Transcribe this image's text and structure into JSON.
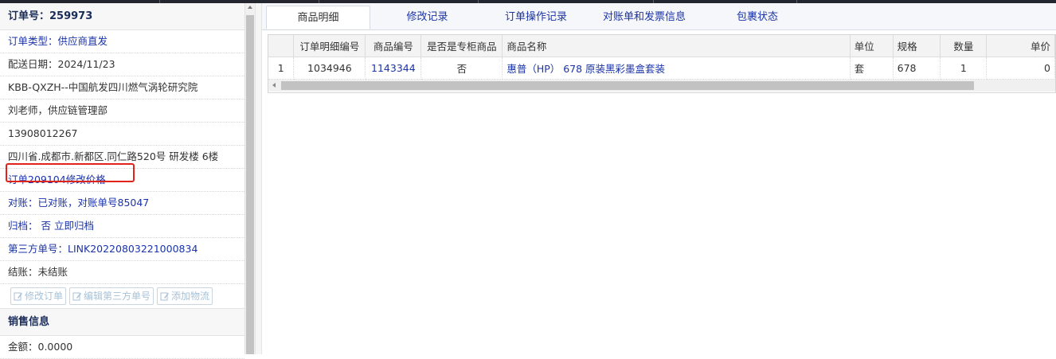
{
  "order": {
    "title": "订单号：259973",
    "type": "订单类型：供应商直发",
    "delivery_date": "配送日期：2024/11/23",
    "customer": "KBB-QXZH--中国航发四川燃气涡轮研究院",
    "contact": "刘老师，供应链管理部",
    "phone": "13908012267",
    "address": "四川省.成都市.新都区.同仁路520号 研发楼 6楼",
    "price_change": "订单209104修改价格",
    "reconcile": "对账：已对账，对账单号85047",
    "archive_prefix": "归档：",
    "archive_status": "否",
    "archive_action": "立即归档",
    "third_party": "第三方单号：LINK20220803221000834",
    "settlement": "结账：未结账"
  },
  "buttons": {
    "edit_order": "修改订单",
    "edit_third_party": "编辑第三方单号",
    "add_logistics": "添加物流"
  },
  "sales": {
    "title": "销售信息",
    "amount": "金额：0.0000"
  },
  "tabs": [
    "商品明细",
    "修改记录",
    "订单操作记录",
    "对账单和发票信息",
    "包裹状态"
  ],
  "table": {
    "headers": [
      "",
      "订单明细编号",
      "商品编号",
      "是否是专柜商品",
      "商品名称",
      "单位",
      "规格",
      "数量",
      "单价"
    ],
    "rows": [
      [
        "1",
        "1034946",
        "1143344",
        "否",
        "惠普（HP） 678 原装黑彩墨盒套装",
        "套",
        "678",
        "1",
        "0"
      ]
    ]
  },
  "colors": {
    "link": "#1a33a8",
    "highlight_border": "#e0241b",
    "header_dark": "#1a2d5a"
  }
}
